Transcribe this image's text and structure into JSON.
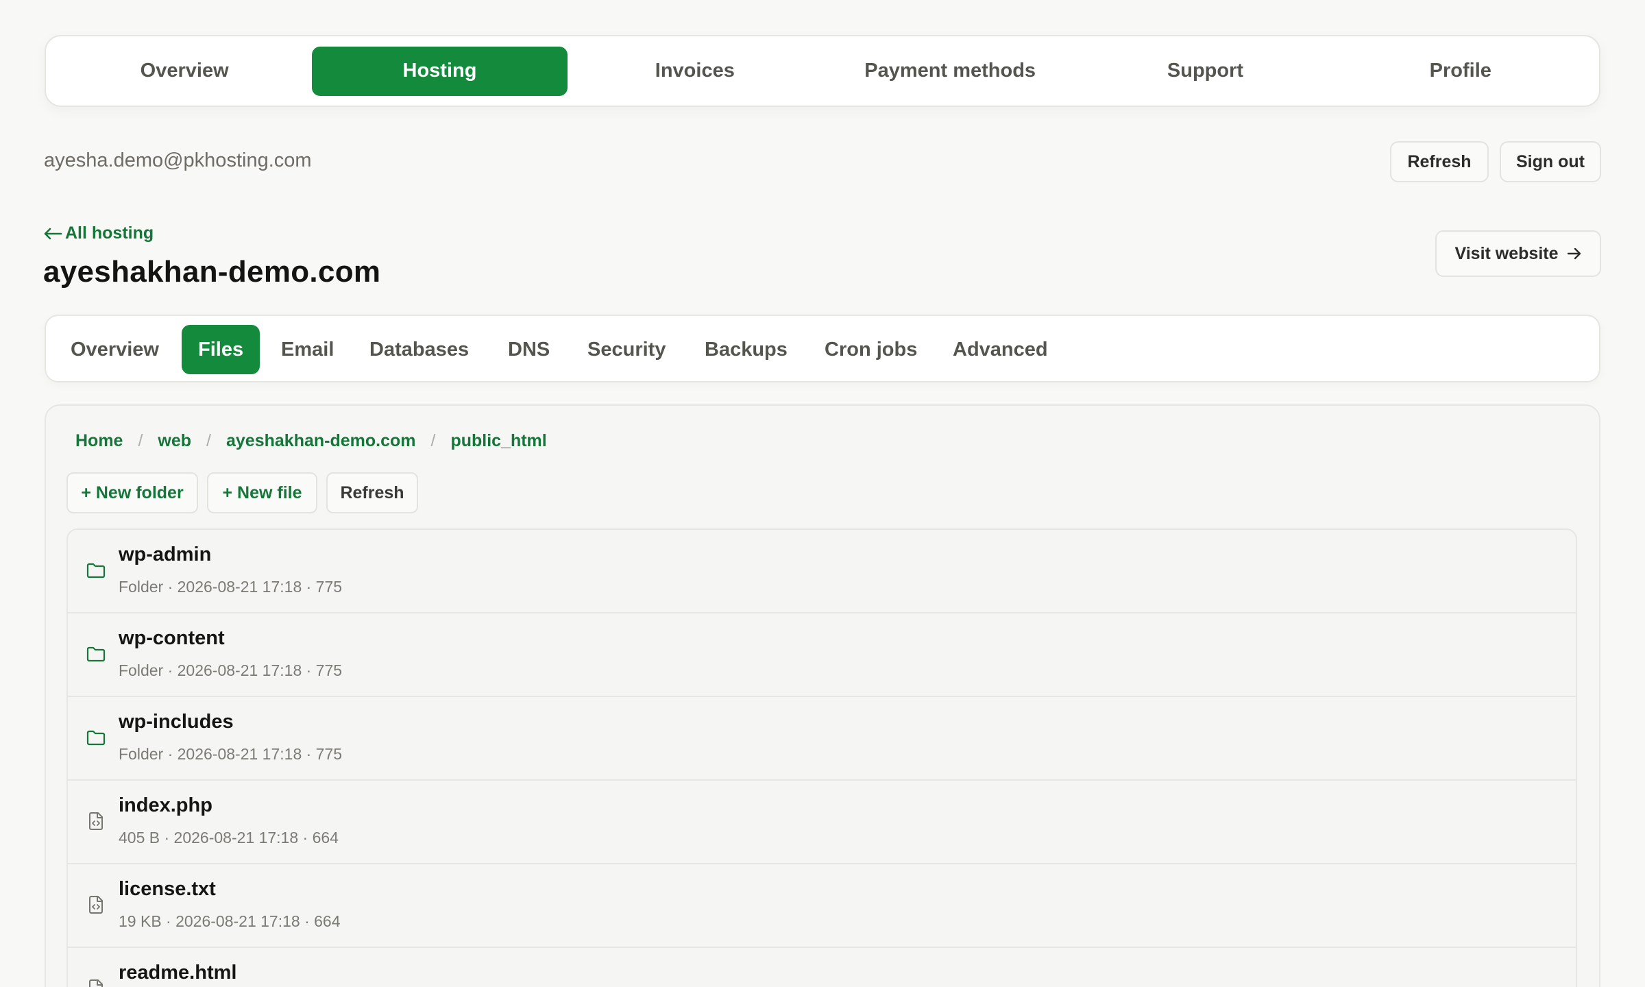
{
  "top_nav": {
    "items": [
      {
        "label": "Overview",
        "active": false
      },
      {
        "label": "Hosting",
        "active": true
      },
      {
        "label": "Invoices",
        "active": false
      },
      {
        "label": "Payment methods",
        "active": false
      },
      {
        "label": "Support",
        "active": false
      },
      {
        "label": "Profile",
        "active": false
      }
    ]
  },
  "account": {
    "email": "ayesha.demo@pkhosting.com",
    "refresh_label": "Refresh",
    "signout_label": "Sign out"
  },
  "site": {
    "back_label": "All hosting",
    "back_icon": "arrow-left-icon",
    "domain": "ayeshakhan-demo.com",
    "visit_label": "Visit website",
    "visit_icon": "arrow-right-icon"
  },
  "sub_nav": {
    "items": [
      {
        "label": "Overview",
        "active": false
      },
      {
        "label": "Files",
        "active": true
      },
      {
        "label": "Email",
        "active": false
      },
      {
        "label": "Databases",
        "active": false
      },
      {
        "label": "DNS",
        "active": false
      },
      {
        "label": "Security",
        "active": false
      },
      {
        "label": "Backups",
        "active": false
      },
      {
        "label": "Cron jobs",
        "active": false
      },
      {
        "label": "Advanced",
        "active": false
      }
    ]
  },
  "files": {
    "breadcrumb": [
      "Home",
      "web",
      "ayeshakhan-demo.com",
      "public_html"
    ],
    "breadcrumb_separator": "/",
    "actions": {
      "new_folder": "+ New folder",
      "new_file": "+ New file",
      "refresh": "Refresh"
    },
    "entries": [
      {
        "name": "wp-admin",
        "meta": "Folder · 2026-08-21 17:18 · 775",
        "icon": "folder-icon"
      },
      {
        "name": "wp-content",
        "meta": "Folder · 2026-08-21 17:18 · 775",
        "icon": "folder-icon"
      },
      {
        "name": "wp-includes",
        "meta": "Folder · 2026-08-21 17:18 · 775",
        "icon": "folder-icon"
      },
      {
        "name": "index.php",
        "meta": "405 B · 2026-08-21 17:18 · 664",
        "icon": "file-code-icon"
      },
      {
        "name": "license.txt",
        "meta": "19 KB · 2026-08-21 17:18 · 664",
        "icon": "file-code-icon"
      },
      {
        "name": "readme.html",
        "meta": "",
        "icon": "file-code-icon"
      }
    ]
  },
  "colors": {
    "accent": "#148a3c",
    "link": "#16763a",
    "background": "#f8f8f7"
  }
}
